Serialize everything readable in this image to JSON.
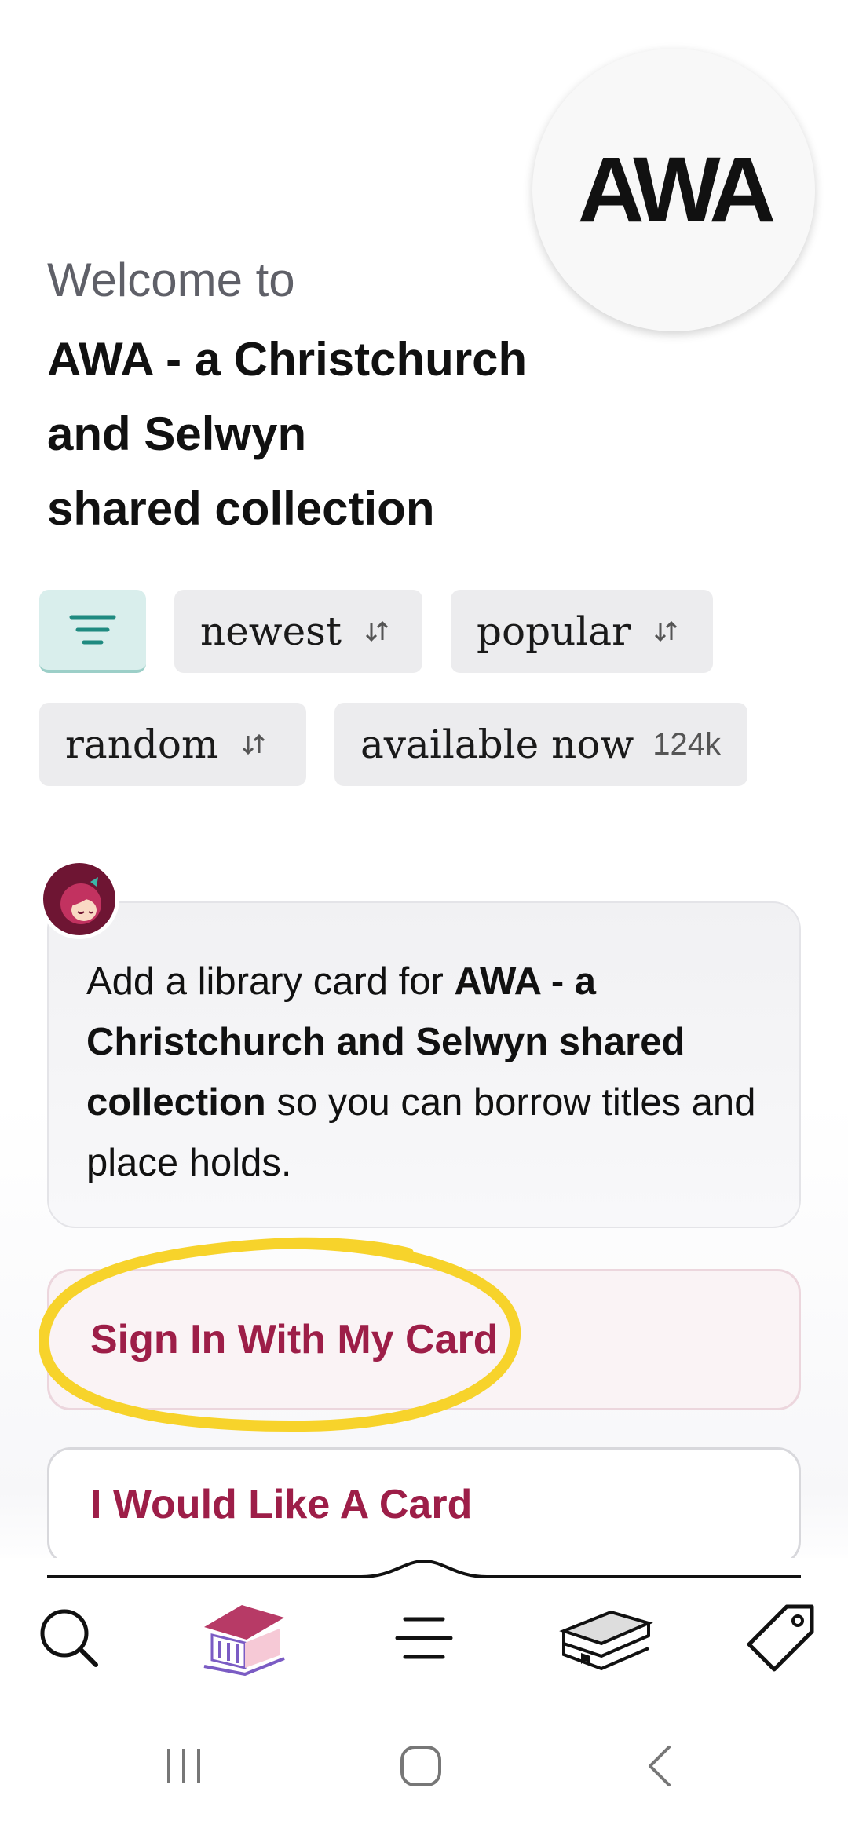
{
  "library": {
    "logo_text": "AWA",
    "welcome": "Welcome to",
    "title_lines": [
      "AWA - a Christchurch",
      "and Selwyn",
      "shared collection"
    ]
  },
  "filters": {
    "filter_icon": "filter-lines-icon",
    "chips": [
      {
        "label": "newest",
        "icon": "sort-arrows-icon"
      },
      {
        "label": "popular",
        "icon": "sort-arrows-icon"
      },
      {
        "label": "random",
        "icon": "sort-arrows-icon"
      },
      {
        "label": "available now",
        "count": "124k"
      }
    ]
  },
  "notice": {
    "avatar_icon": "libby-avatar-icon",
    "text_before": "Add a library card for ",
    "library_name": "AWA - a Christchurch and Selwyn shared collection",
    "text_after": " so you can borrow titles and place holds."
  },
  "actions": {
    "sign_in": "Sign In With My Card",
    "want_card": "I Would Like A Card"
  },
  "bottom_nav": {
    "items": [
      "search-icon",
      "library-icon",
      "menu-icon",
      "shelf-books-icon",
      "tag-icon"
    ]
  },
  "system_nav": {
    "items": [
      "recent-apps-icon",
      "home-icon",
      "back-icon"
    ]
  },
  "colors": {
    "accent": "#9d1e48",
    "filter_teal": "#1f8a80",
    "highlight": "#f7d32b",
    "library_purple": "#7b5cc4"
  }
}
